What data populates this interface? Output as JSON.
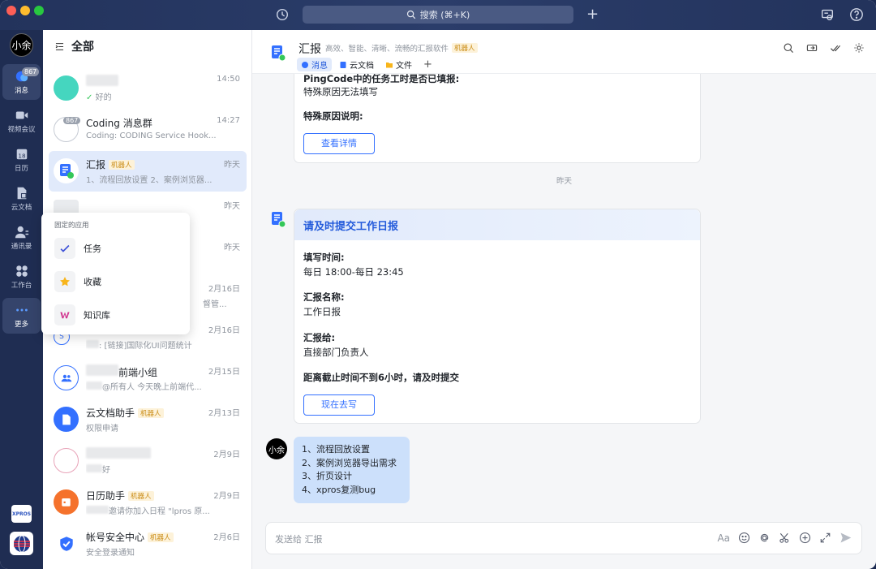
{
  "toolbar": {
    "search_placeholder": "搜索 (⌘+K)",
    "plus": "+"
  },
  "rail": {
    "me": "小余",
    "items": [
      {
        "label": "消息",
        "badge": "867"
      },
      {
        "label": "视频会议"
      },
      {
        "label": "日历",
        "day": "18"
      },
      {
        "label": "云文档"
      },
      {
        "label": "通讯录"
      },
      {
        "label": "工作台"
      },
      {
        "label": "更多"
      }
    ],
    "xpros": "XPROS"
  },
  "list": {
    "title": "全部",
    "convs": [
      {
        "name": "",
        "msg": "好的",
        "time": "14:50"
      },
      {
        "name": "Coding 消息群",
        "msg": "Coding: CODING Service Hook...",
        "time": "14:27",
        "badge": "867"
      },
      {
        "name": "汇报",
        "tag": "机器人",
        "msg": "1、流程回放设置 2、案例浏览器...",
        "time": "昨天"
      },
      {
        "name": "",
        "msg": "",
        "time": "昨天"
      },
      {
        "name": "",
        "msg": "",
        "time": "昨天"
      },
      {
        "name": "",
        "msg": "督管...",
        "time": "2月16日"
      },
      {
        "name": "",
        "msg": ": [链接]国际化UI问题统计",
        "time": "2月16日"
      },
      {
        "name": "前端小组",
        "msg": "@所有人 今天晚上前端代...",
        "time": "2月15日"
      },
      {
        "name": "云文档助手",
        "tag": "机器人",
        "msg": "权限申请",
        "time": "2月13日"
      },
      {
        "name": "",
        "msg": "好",
        "time": "2月9日"
      },
      {
        "name": "日历助手",
        "tag": "机器人",
        "msg": "邀请你加入日程 \"lpros 原...",
        "time": "2月9日"
      },
      {
        "name": "帐号安全中心",
        "tag": "机器人",
        "msg": "安全登录通知",
        "time": "2月6日"
      }
    ]
  },
  "popup": {
    "title": "固定的应用",
    "items": [
      "任务",
      "收藏",
      "知识库"
    ]
  },
  "chat": {
    "title": "汇报",
    "subtitle": "高效、智能、清晰、流畅的汇报软件",
    "tag": "机器人",
    "tabs": [
      "消息",
      "云文档",
      "文件"
    ],
    "card1": {
      "line1": "PingCode中的任务工时是否已填报:",
      "line2": "特殊原因无法填写",
      "line3": "特殊原因说明:",
      "button": "查看详情"
    },
    "day": "昨天",
    "card2": {
      "title": "请及时提交工作日报",
      "k1": "填写时间:",
      "v1": "每日 18:00-每日 23:45",
      "k2": "汇报名称:",
      "v2": "工作日报",
      "k3": "汇报给:",
      "v3": "直接部门负责人",
      "note": "距离截止时间不到6小时，请及时提交",
      "button": "现在去写"
    },
    "me": "小余",
    "bubble": [
      "1、流程回放设置",
      "2、案例浏览器导出需求",
      "3、折页设计",
      "4、xpros复测bug"
    ],
    "input_placeholder": "发送给 汇报",
    "font_label": "Aa"
  },
  "colors": {
    "accent": "#3370ff",
    "rail": "#1f2d52",
    "selected": "#e1eafb"
  }
}
